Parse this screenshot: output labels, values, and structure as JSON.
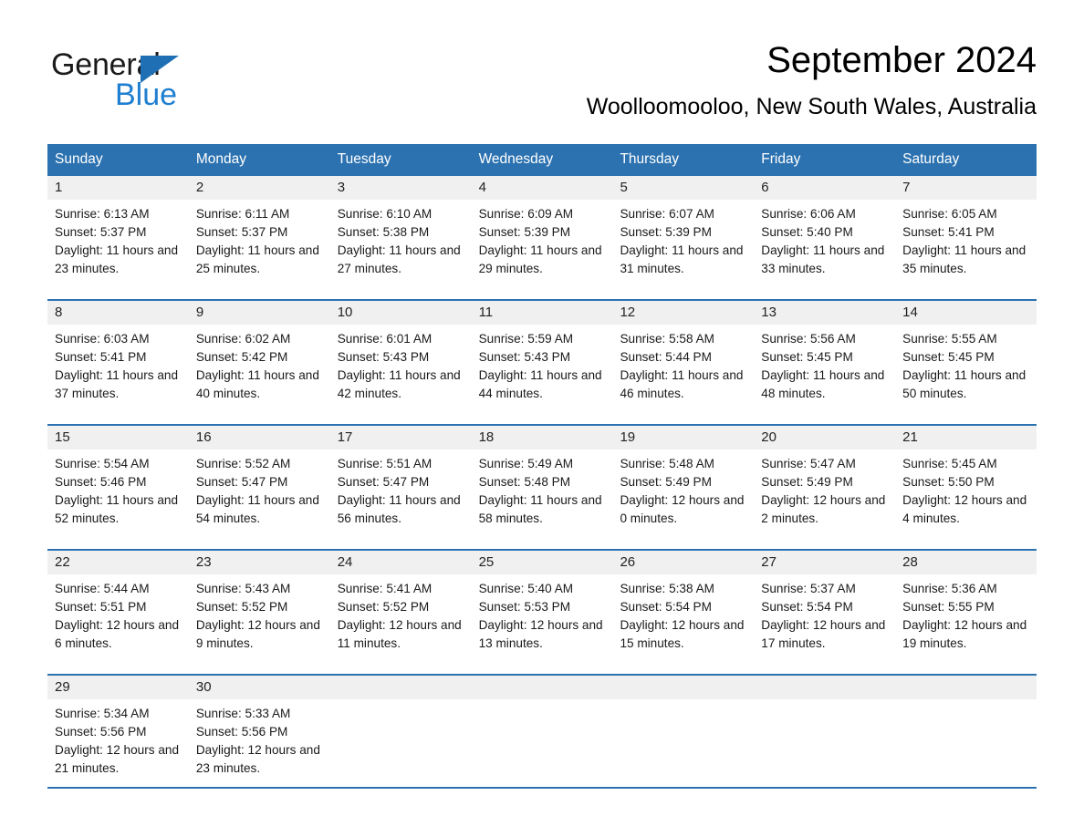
{
  "brand": {
    "name_part1": "General",
    "name_part2": "Blue",
    "triangle_color": "#1f6fb5",
    "blue_color": "#1f7fd0"
  },
  "header": {
    "month_title": "September 2024",
    "location": "Woolloomooloo, New South Wales, Australia"
  },
  "theme": {
    "header_blue": "#2c72b0",
    "day_band_gray": "#f0f0f0",
    "page_background": "#ffffff"
  },
  "weekdays": [
    "Sunday",
    "Monday",
    "Tuesday",
    "Wednesday",
    "Thursday",
    "Friday",
    "Saturday"
  ],
  "weeks": [
    [
      {
        "day": "1",
        "sunrise": "Sunrise: 6:13 AM",
        "sunset": "Sunset: 5:37 PM",
        "daylight": "Daylight: 11 hours and 23 minutes."
      },
      {
        "day": "2",
        "sunrise": "Sunrise: 6:11 AM",
        "sunset": "Sunset: 5:37 PM",
        "daylight": "Daylight: 11 hours and 25 minutes."
      },
      {
        "day": "3",
        "sunrise": "Sunrise: 6:10 AM",
        "sunset": "Sunset: 5:38 PM",
        "daylight": "Daylight: 11 hours and 27 minutes."
      },
      {
        "day": "4",
        "sunrise": "Sunrise: 6:09 AM",
        "sunset": "Sunset: 5:39 PM",
        "daylight": "Daylight: 11 hours and 29 minutes."
      },
      {
        "day": "5",
        "sunrise": "Sunrise: 6:07 AM",
        "sunset": "Sunset: 5:39 PM",
        "daylight": "Daylight: 11 hours and 31 minutes."
      },
      {
        "day": "6",
        "sunrise": "Sunrise: 6:06 AM",
        "sunset": "Sunset: 5:40 PM",
        "daylight": "Daylight: 11 hours and 33 minutes."
      },
      {
        "day": "7",
        "sunrise": "Sunrise: 6:05 AM",
        "sunset": "Sunset: 5:41 PM",
        "daylight": "Daylight: 11 hours and 35 minutes."
      }
    ],
    [
      {
        "day": "8",
        "sunrise": "Sunrise: 6:03 AM",
        "sunset": "Sunset: 5:41 PM",
        "daylight": "Daylight: 11 hours and 37 minutes."
      },
      {
        "day": "9",
        "sunrise": "Sunrise: 6:02 AM",
        "sunset": "Sunset: 5:42 PM",
        "daylight": "Daylight: 11 hours and 40 minutes."
      },
      {
        "day": "10",
        "sunrise": "Sunrise: 6:01 AM",
        "sunset": "Sunset: 5:43 PM",
        "daylight": "Daylight: 11 hours and 42 minutes."
      },
      {
        "day": "11",
        "sunrise": "Sunrise: 5:59 AM",
        "sunset": "Sunset: 5:43 PM",
        "daylight": "Daylight: 11 hours and 44 minutes."
      },
      {
        "day": "12",
        "sunrise": "Sunrise: 5:58 AM",
        "sunset": "Sunset: 5:44 PM",
        "daylight": "Daylight: 11 hours and 46 minutes."
      },
      {
        "day": "13",
        "sunrise": "Sunrise: 5:56 AM",
        "sunset": "Sunset: 5:45 PM",
        "daylight": "Daylight: 11 hours and 48 minutes."
      },
      {
        "day": "14",
        "sunrise": "Sunrise: 5:55 AM",
        "sunset": "Sunset: 5:45 PM",
        "daylight": "Daylight: 11 hours and 50 minutes."
      }
    ],
    [
      {
        "day": "15",
        "sunrise": "Sunrise: 5:54 AM",
        "sunset": "Sunset: 5:46 PM",
        "daylight": "Daylight: 11 hours and 52 minutes."
      },
      {
        "day": "16",
        "sunrise": "Sunrise: 5:52 AM",
        "sunset": "Sunset: 5:47 PM",
        "daylight": "Daylight: 11 hours and 54 minutes."
      },
      {
        "day": "17",
        "sunrise": "Sunrise: 5:51 AM",
        "sunset": "Sunset: 5:47 PM",
        "daylight": "Daylight: 11 hours and 56 minutes."
      },
      {
        "day": "18",
        "sunrise": "Sunrise: 5:49 AM",
        "sunset": "Sunset: 5:48 PM",
        "daylight": "Daylight: 11 hours and 58 minutes."
      },
      {
        "day": "19",
        "sunrise": "Sunrise: 5:48 AM",
        "sunset": "Sunset: 5:49 PM",
        "daylight": "Daylight: 12 hours and 0 minutes."
      },
      {
        "day": "20",
        "sunrise": "Sunrise: 5:47 AM",
        "sunset": "Sunset: 5:49 PM",
        "daylight": "Daylight: 12 hours and 2 minutes."
      },
      {
        "day": "21",
        "sunrise": "Sunrise: 5:45 AM",
        "sunset": "Sunset: 5:50 PM",
        "daylight": "Daylight: 12 hours and 4 minutes."
      }
    ],
    [
      {
        "day": "22",
        "sunrise": "Sunrise: 5:44 AM",
        "sunset": "Sunset: 5:51 PM",
        "daylight": "Daylight: 12 hours and 6 minutes."
      },
      {
        "day": "23",
        "sunrise": "Sunrise: 5:43 AM",
        "sunset": "Sunset: 5:52 PM",
        "daylight": "Daylight: 12 hours and 9 minutes."
      },
      {
        "day": "24",
        "sunrise": "Sunrise: 5:41 AM",
        "sunset": "Sunset: 5:52 PM",
        "daylight": "Daylight: 12 hours and 11 minutes."
      },
      {
        "day": "25",
        "sunrise": "Sunrise: 5:40 AM",
        "sunset": "Sunset: 5:53 PM",
        "daylight": "Daylight: 12 hours and 13 minutes."
      },
      {
        "day": "26",
        "sunrise": "Sunrise: 5:38 AM",
        "sunset": "Sunset: 5:54 PM",
        "daylight": "Daylight: 12 hours and 15 minutes."
      },
      {
        "day": "27",
        "sunrise": "Sunrise: 5:37 AM",
        "sunset": "Sunset: 5:54 PM",
        "daylight": "Daylight: 12 hours and 17 minutes."
      },
      {
        "day": "28",
        "sunrise": "Sunrise: 5:36 AM",
        "sunset": "Sunset: 5:55 PM",
        "daylight": "Daylight: 12 hours and 19 minutes."
      }
    ],
    [
      {
        "day": "29",
        "sunrise": "Sunrise: 5:34 AM",
        "sunset": "Sunset: 5:56 PM",
        "daylight": "Daylight: 12 hours and 21 minutes."
      },
      {
        "day": "30",
        "sunrise": "Sunrise: 5:33 AM",
        "sunset": "Sunset: 5:56 PM",
        "daylight": "Daylight: 12 hours and 23 minutes."
      },
      {
        "day": "",
        "sunrise": "",
        "sunset": "",
        "daylight": ""
      },
      {
        "day": "",
        "sunrise": "",
        "sunset": "",
        "daylight": ""
      },
      {
        "day": "",
        "sunrise": "",
        "sunset": "",
        "daylight": ""
      },
      {
        "day": "",
        "sunrise": "",
        "sunset": "",
        "daylight": ""
      },
      {
        "day": "",
        "sunrise": "",
        "sunset": "",
        "daylight": ""
      }
    ]
  ]
}
